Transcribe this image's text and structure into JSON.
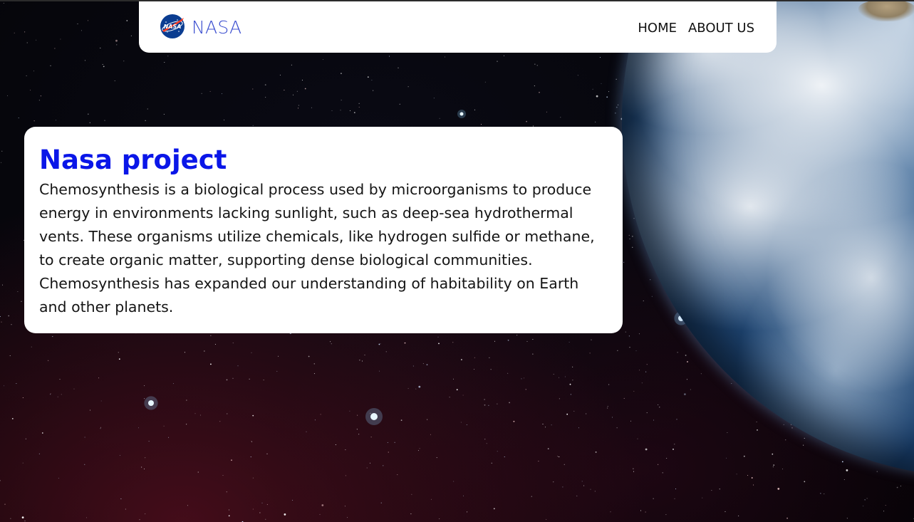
{
  "navbar": {
    "logo_icon": "nasa-meatball-logo-icon",
    "brand": "NASA",
    "links": [
      {
        "label": "HOME"
      },
      {
        "label": "ABOUT US"
      }
    ]
  },
  "hero": {
    "title": "Nasa project",
    "body": "Chemosynthesis is a biological process used by microorganisms to produce energy in environments lacking sunlight, such as deep-sea hydrothermal vents. These organisms utilize chemicals, like hydrogen sulfide or methane, to create organic matter, supporting dense biological communities. Chemosynthesis has expanded our understanding of habitability on Earth and other planets."
  },
  "background": {
    "image": "space-starfield-with-earth"
  },
  "colors": {
    "brand": "#3c4fd0",
    "title": "#0a16e8",
    "card_bg": "#ffffff",
    "nav_bg": "#ffffff"
  }
}
